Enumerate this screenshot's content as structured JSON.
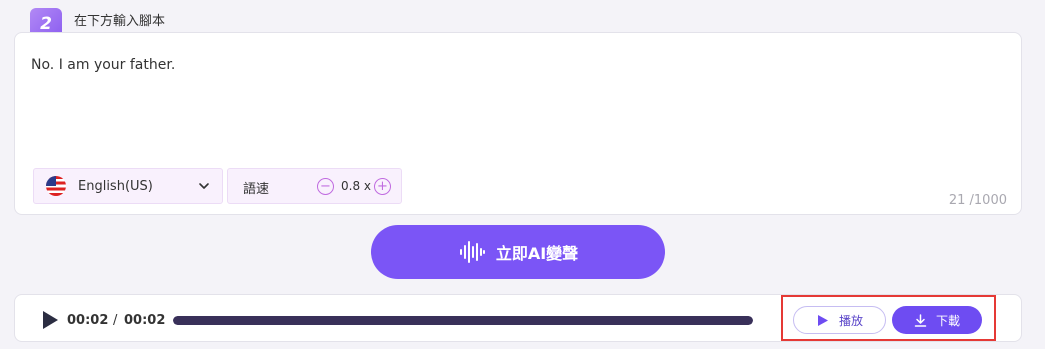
{
  "step": {
    "number": "2",
    "title": "在下方輸入腳本"
  },
  "editor": {
    "text": "No. I am your father.",
    "char_count": "21 /1000"
  },
  "language": {
    "selected": "English(US)",
    "icon": "us-flag-icon"
  },
  "speed": {
    "label": "語速",
    "value": "0.8 x",
    "minus_icon": "minus-circle-icon",
    "plus_icon": "plus-circle-icon"
  },
  "convert_button": {
    "label": "立即AI變聲",
    "icon": "sound-wave-icon"
  },
  "player": {
    "current_time": "00:02",
    "separator": "/",
    "total_time": "00:02",
    "progress": 1.0,
    "play_button_label": "播放",
    "download_button_label": "下載"
  },
  "colors": {
    "accent": "#7b55f6",
    "badge": "#9d6ef3",
    "highlight": "#e53935"
  }
}
